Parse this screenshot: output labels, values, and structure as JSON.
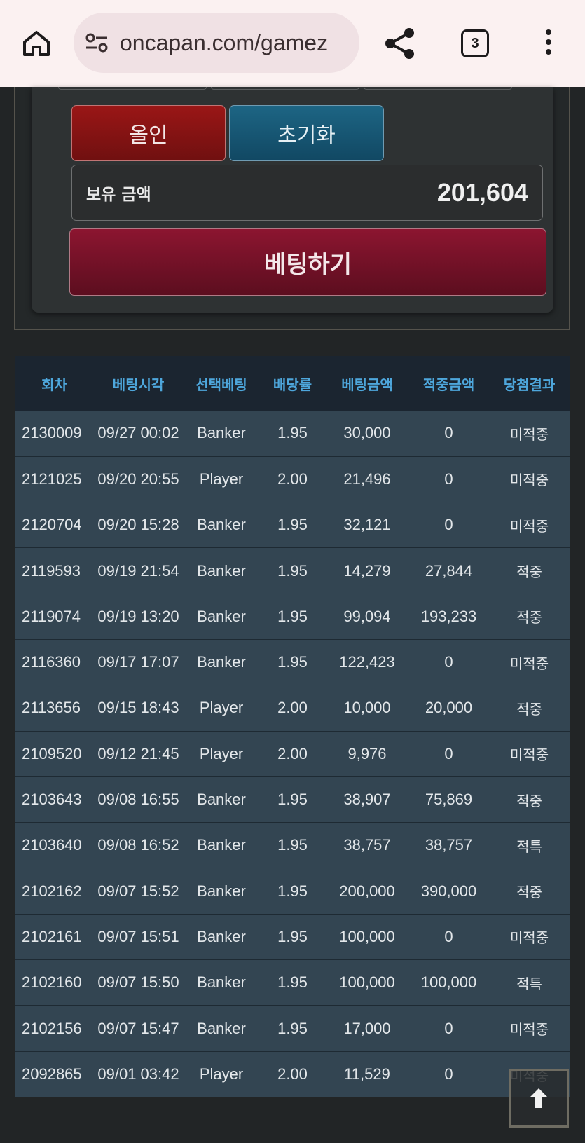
{
  "browser": {
    "url": "oncapan.com/gamez",
    "tab_count": "3"
  },
  "bet_panel": {
    "allin_label": "올인",
    "reset_label": "초기화",
    "balance_label": "보유 금액",
    "balance_value": "201,604",
    "bet_button_label": "베팅하기"
  },
  "history": {
    "headers": [
      "회차",
      "베팅시각",
      "선택베팅",
      "배당률",
      "베팅금액",
      "적중금액",
      "당첨결과"
    ],
    "rows": [
      {
        "round": "2130009",
        "time": "09/27 00:02",
        "pick": "Banker",
        "odds": "1.95",
        "bet": "30,000",
        "win": "0",
        "result": "미적중",
        "status": "lose"
      },
      {
        "round": "2121025",
        "time": "09/20 20:55",
        "pick": "Player",
        "odds": "2.00",
        "bet": "21,496",
        "win": "0",
        "result": "미적중",
        "status": "lose"
      },
      {
        "round": "2120704",
        "time": "09/20 15:28",
        "pick": "Banker",
        "odds": "1.95",
        "bet": "32,121",
        "win": "0",
        "result": "미적중",
        "status": "lose"
      },
      {
        "round": "2119593",
        "time": "09/19 21:54",
        "pick": "Banker",
        "odds": "1.95",
        "bet": "14,279",
        "win": "27,844",
        "result": "적중",
        "status": "win"
      },
      {
        "round": "2119074",
        "time": "09/19 13:20",
        "pick": "Banker",
        "odds": "1.95",
        "bet": "99,094",
        "win": "193,233",
        "result": "적중",
        "status": "win"
      },
      {
        "round": "2116360",
        "time": "09/17 17:07",
        "pick": "Banker",
        "odds": "1.95",
        "bet": "122,423",
        "win": "0",
        "result": "미적중",
        "status": "lose"
      },
      {
        "round": "2113656",
        "time": "09/15 18:43",
        "pick": "Player",
        "odds": "2.00",
        "bet": "10,000",
        "win": "20,000",
        "result": "적중",
        "status": "win"
      },
      {
        "round": "2109520",
        "time": "09/12 21:45",
        "pick": "Player",
        "odds": "2.00",
        "bet": "9,976",
        "win": "0",
        "result": "미적중",
        "status": "lose"
      },
      {
        "round": "2103643",
        "time": "09/08 16:55",
        "pick": "Banker",
        "odds": "1.95",
        "bet": "38,907",
        "win": "75,869",
        "result": "적중",
        "status": "win"
      },
      {
        "round": "2103640",
        "time": "09/08 16:52",
        "pick": "Banker",
        "odds": "1.95",
        "bet": "38,757",
        "win": "38,757",
        "result": "적특",
        "status": "win"
      },
      {
        "round": "2102162",
        "time": "09/07 15:52",
        "pick": "Banker",
        "odds": "1.95",
        "bet": "200,000",
        "win": "390,000",
        "result": "적중",
        "status": "win"
      },
      {
        "round": "2102161",
        "time": "09/07 15:51",
        "pick": "Banker",
        "odds": "1.95",
        "bet": "100,000",
        "win": "0",
        "result": "미적중",
        "status": "lose"
      },
      {
        "round": "2102160",
        "time": "09/07 15:50",
        "pick": "Banker",
        "odds": "1.95",
        "bet": "100,000",
        "win": "100,000",
        "result": "적특",
        "status": "win"
      },
      {
        "round": "2102156",
        "time": "09/07 15:47",
        "pick": "Banker",
        "odds": "1.95",
        "bet": "17,000",
        "win": "0",
        "result": "미적중",
        "status": "lose"
      },
      {
        "round": "2092865",
        "time": "09/01 03:42",
        "pick": "Player",
        "odds": "2.00",
        "bet": "11,529",
        "win": "0",
        "result": "미적중",
        "status": "lose"
      }
    ]
  },
  "icons": {
    "home": "home-icon",
    "site_settings": "tune-icon",
    "share": "share-icon",
    "tabs": "tab-switcher-icon",
    "menu": "more-vert-icon",
    "scroll_top": "arrow-up-icon"
  },
  "colors": {
    "lose": "#e03a3a",
    "win": "#f0a830",
    "header_text": "#4ea7dc",
    "allin": "#8a1414",
    "reset": "#185a78",
    "bet": "#7a1228"
  }
}
